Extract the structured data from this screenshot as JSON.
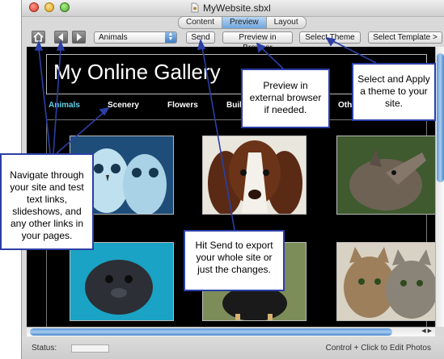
{
  "window": {
    "title": "MyWebsite.sbxl",
    "tabs": [
      {
        "label": "Content",
        "active": false
      },
      {
        "label": "Preview",
        "active": true
      },
      {
        "label": "Layout",
        "active": false
      }
    ]
  },
  "toolbar": {
    "page_select_value": "Animals",
    "send_label": "Send",
    "preview_browser_label": "Preview in Browser",
    "select_theme_label": "Select Theme",
    "select_template_label": "Select Template >"
  },
  "site": {
    "title": "My Online Gallery",
    "nav": [
      {
        "label": "Animals",
        "active": true
      },
      {
        "label": "Scenery",
        "active": false
      },
      {
        "label": "Flowers",
        "active": false
      },
      {
        "label": "Buil",
        "active": false
      },
      {
        "label": "Othe",
        "active": false
      }
    ],
    "photos": [
      "owls",
      "spaniel",
      "wolf-pup",
      "seal",
      "ostrich",
      "cats"
    ]
  },
  "status": {
    "label": "Status:",
    "hint": "Control + Click to Edit Photos"
  },
  "callouts": {
    "navigate": "Navigate through your site and test text links, slideshows, and any other links in your pages.",
    "preview": "Preview in external browser if needed.",
    "theme": "Select and Apply a theme to your site.",
    "send": "Hit Send to export your whole site or just the changes."
  },
  "colors": {
    "callout_border": "#2c3fa6",
    "active_nav": "#5fd0e6",
    "tab_active": "#6fa6dd"
  }
}
